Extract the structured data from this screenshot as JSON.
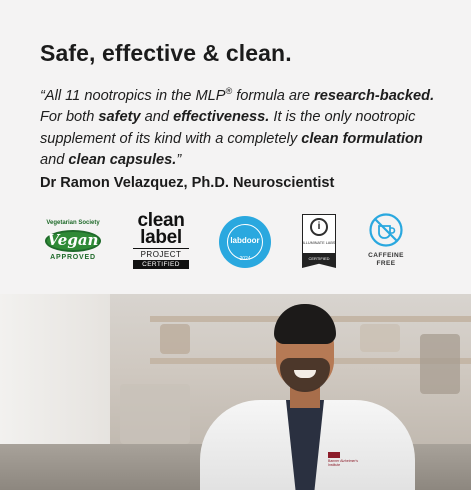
{
  "headline": "Safe, effective & clean.",
  "quote": {
    "p1": "“All 11 nootropics in the MLP",
    "reg": "®",
    "p2": " formula are ",
    "b1": "research-backed.",
    "p3": " For both ",
    "b2": "safety",
    "p4": " and ",
    "b3": "effectiveness.",
    "p5": " It is the only nootropic supplement of its kind with a completely ",
    "b4": "clean formulation",
    "p6": " and ",
    "b5": "clean capsules.",
    "p7": "”"
  },
  "author": "Dr Ramon Velazquez, Ph.D. Neuroscientist",
  "badges": {
    "vegan": {
      "top": "Vegetarian Society",
      "word": "Vegan",
      "bottom": "APPROVED",
      "color": "#2f8a36"
    },
    "clean_label": {
      "l1": "clean",
      "l2": "label",
      "l3": "PROJECT",
      "l4": "CERTIFIED"
    },
    "labdoor": {
      "word": "labdoor",
      "year": "2024",
      "color": "#2aa8df"
    },
    "illuminate": {
      "mark": "i",
      "text": "ILLUMINATE LABS",
      "ribbon": "CERTIFIED"
    },
    "caffeine": {
      "l1": "CAFFEINE",
      "l2": "FREE",
      "color": "#2aa8df"
    }
  },
  "photo": {
    "patch_text": "Banner Alzheimer's Institute"
  }
}
